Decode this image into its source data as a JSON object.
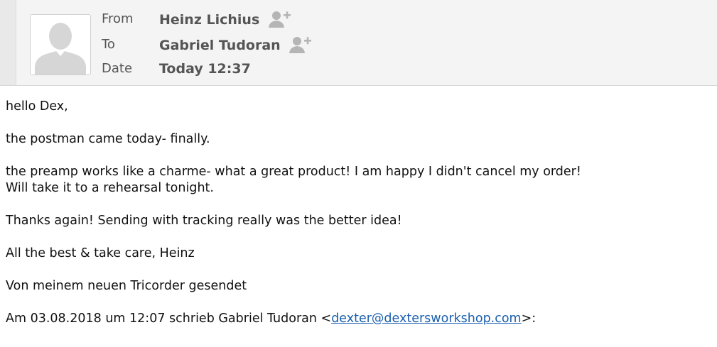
{
  "header": {
    "from_label": "From",
    "from_value": "Heinz Lichius",
    "to_label": "To",
    "to_value": "Gabriel Tudoran",
    "date_label": "Date",
    "date_value": "Today 12:37"
  },
  "icons": {
    "avatar": "avatar-placeholder-icon",
    "add_contact": "add-contact-icon"
  },
  "colors": {
    "header_bg": "#f4f4f4",
    "link": "#1a5fae",
    "icon": "#b5b5b5"
  },
  "message": {
    "greeting": "hello Dex,",
    "line1": "the postman came today- finally.",
    "line2a": "the preamp works like a charme- what a great product! I am happy I didn't cancel my order!",
    "line2b": "Will take it to a rehearsal tonight.",
    "line3": "Thanks again! Sending with tracking really was the better idea!",
    "line4": "All the best & take care, Heinz",
    "signature": "Von meinem neuen Tricorder gesendet",
    "quote_prefix": "Am 03.08.2018 um 12:07 schrieb Gabriel Tudoran <",
    "quote_email": "dexter@dextersworkshop.com",
    "quote_suffix": ">:"
  }
}
